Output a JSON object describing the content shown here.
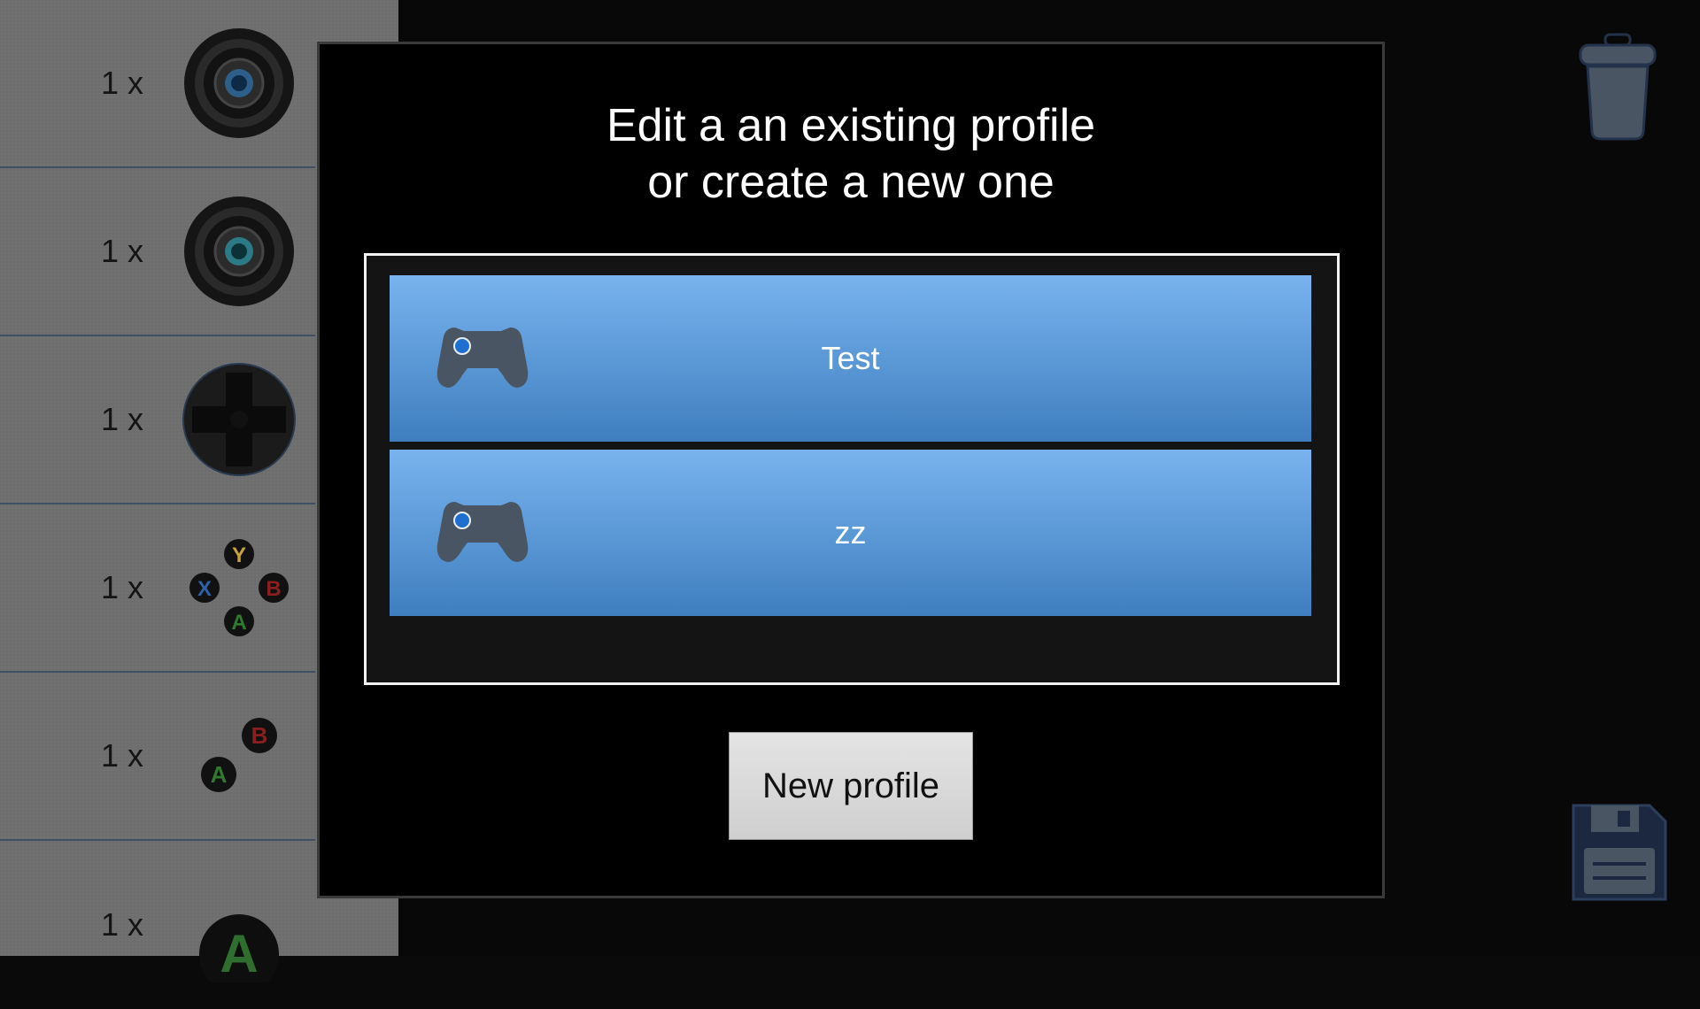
{
  "palette": {
    "items": [
      {
        "count": "1 x",
        "icon": "analog-stick-icon"
      },
      {
        "count": "1 x",
        "icon": "analog-stick-icon"
      },
      {
        "count": "1 x",
        "icon": "dpad-icon"
      },
      {
        "count": "1 x",
        "icon": "xyab-buttons-icon",
        "labels": [
          "Y",
          "X",
          "B",
          "A"
        ]
      },
      {
        "count": "1 x",
        "icon": "ab-buttons-icon",
        "labels": [
          "B",
          "A"
        ]
      },
      {
        "count": "1 x",
        "icon": "a-button-icon",
        "labels": [
          "A"
        ]
      }
    ]
  },
  "dialog": {
    "title_line1": "Edit a an existing profile",
    "title_line2": "or create a new one",
    "profiles": [
      {
        "name": "Test",
        "icon": "gamepad-icon"
      },
      {
        "name": "zz",
        "icon": "gamepad-icon"
      }
    ],
    "new_profile_label": "New profile"
  },
  "toolbar": {
    "delete_icon": "trash-icon",
    "save_icon": "floppy-disk-icon"
  },
  "colors": {
    "profile_item_top": "#78b3ee",
    "profile_item_bottom": "#3f7ebf",
    "icon_slate": "#4a5563",
    "y_color": "#c8a23a",
    "x_color": "#2f5fa8",
    "b_color": "#8a1f1f",
    "a_color": "#2f7a2f"
  }
}
